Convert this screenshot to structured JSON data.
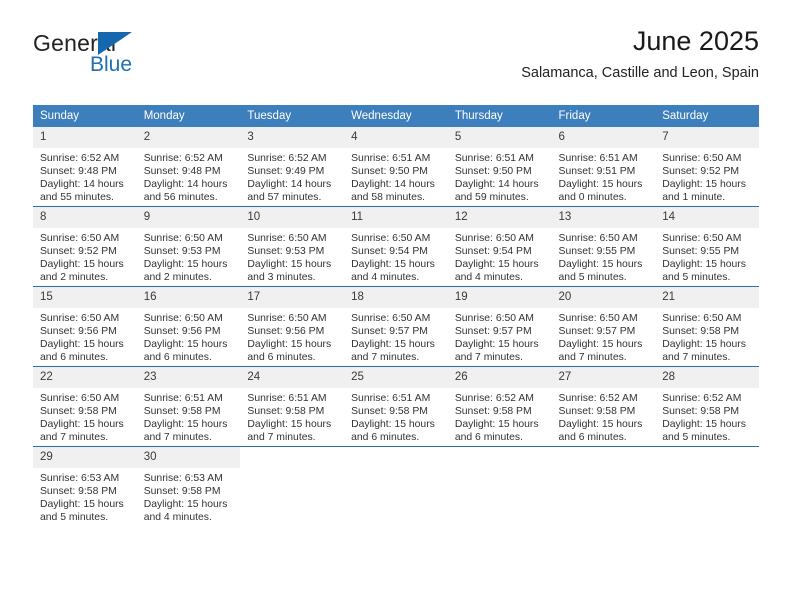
{
  "brand": {
    "name_part1": "General",
    "name_part2": "Blue",
    "flag_icon": "blue-flag-icon",
    "accent_color": "#1568ad"
  },
  "header": {
    "title": "June 2025",
    "subtitle": "Salamanca, Castille and Leon, Spain"
  },
  "theme": {
    "header_row_background": "#3d7ebd",
    "row_divider_color": "#2e6da4",
    "daynum_background": "#f0f0f0"
  },
  "calendar": {
    "weekday_headers": [
      "Sunday",
      "Monday",
      "Tuesday",
      "Wednesday",
      "Thursday",
      "Friday",
      "Saturday"
    ],
    "weeks": [
      [
        {
          "day": "1",
          "sunrise": "Sunrise: 6:52 AM",
          "sunset": "Sunset: 9:48 PM",
          "daylight_line1": "Daylight: 14 hours",
          "daylight_line2": "and 55 minutes."
        },
        {
          "day": "2",
          "sunrise": "Sunrise: 6:52 AM",
          "sunset": "Sunset: 9:48 PM",
          "daylight_line1": "Daylight: 14 hours",
          "daylight_line2": "and 56 minutes."
        },
        {
          "day": "3",
          "sunrise": "Sunrise: 6:52 AM",
          "sunset": "Sunset: 9:49 PM",
          "daylight_line1": "Daylight: 14 hours",
          "daylight_line2": "and 57 minutes."
        },
        {
          "day": "4",
          "sunrise": "Sunrise: 6:51 AM",
          "sunset": "Sunset: 9:50 PM",
          "daylight_line1": "Daylight: 14 hours",
          "daylight_line2": "and 58 minutes."
        },
        {
          "day": "5",
          "sunrise": "Sunrise: 6:51 AM",
          "sunset": "Sunset: 9:50 PM",
          "daylight_line1": "Daylight: 14 hours",
          "daylight_line2": "and 59 minutes."
        },
        {
          "day": "6",
          "sunrise": "Sunrise: 6:51 AM",
          "sunset": "Sunset: 9:51 PM",
          "daylight_line1": "Daylight: 15 hours",
          "daylight_line2": "and 0 minutes."
        },
        {
          "day": "7",
          "sunrise": "Sunrise: 6:50 AM",
          "sunset": "Sunset: 9:52 PM",
          "daylight_line1": "Daylight: 15 hours",
          "daylight_line2": "and 1 minute."
        }
      ],
      [
        {
          "day": "8",
          "sunrise": "Sunrise: 6:50 AM",
          "sunset": "Sunset: 9:52 PM",
          "daylight_line1": "Daylight: 15 hours",
          "daylight_line2": "and 2 minutes."
        },
        {
          "day": "9",
          "sunrise": "Sunrise: 6:50 AM",
          "sunset": "Sunset: 9:53 PM",
          "daylight_line1": "Daylight: 15 hours",
          "daylight_line2": "and 2 minutes."
        },
        {
          "day": "10",
          "sunrise": "Sunrise: 6:50 AM",
          "sunset": "Sunset: 9:53 PM",
          "daylight_line1": "Daylight: 15 hours",
          "daylight_line2": "and 3 minutes."
        },
        {
          "day": "11",
          "sunrise": "Sunrise: 6:50 AM",
          "sunset": "Sunset: 9:54 PM",
          "daylight_line1": "Daylight: 15 hours",
          "daylight_line2": "and 4 minutes."
        },
        {
          "day": "12",
          "sunrise": "Sunrise: 6:50 AM",
          "sunset": "Sunset: 9:54 PM",
          "daylight_line1": "Daylight: 15 hours",
          "daylight_line2": "and 4 minutes."
        },
        {
          "day": "13",
          "sunrise": "Sunrise: 6:50 AM",
          "sunset": "Sunset: 9:55 PM",
          "daylight_line1": "Daylight: 15 hours",
          "daylight_line2": "and 5 minutes."
        },
        {
          "day": "14",
          "sunrise": "Sunrise: 6:50 AM",
          "sunset": "Sunset: 9:55 PM",
          "daylight_line1": "Daylight: 15 hours",
          "daylight_line2": "and 5 minutes."
        }
      ],
      [
        {
          "day": "15",
          "sunrise": "Sunrise: 6:50 AM",
          "sunset": "Sunset: 9:56 PM",
          "daylight_line1": "Daylight: 15 hours",
          "daylight_line2": "and 6 minutes."
        },
        {
          "day": "16",
          "sunrise": "Sunrise: 6:50 AM",
          "sunset": "Sunset: 9:56 PM",
          "daylight_line1": "Daylight: 15 hours",
          "daylight_line2": "and 6 minutes."
        },
        {
          "day": "17",
          "sunrise": "Sunrise: 6:50 AM",
          "sunset": "Sunset: 9:56 PM",
          "daylight_line1": "Daylight: 15 hours",
          "daylight_line2": "and 6 minutes."
        },
        {
          "day": "18",
          "sunrise": "Sunrise: 6:50 AM",
          "sunset": "Sunset: 9:57 PM",
          "daylight_line1": "Daylight: 15 hours",
          "daylight_line2": "and 7 minutes."
        },
        {
          "day": "19",
          "sunrise": "Sunrise: 6:50 AM",
          "sunset": "Sunset: 9:57 PM",
          "daylight_line1": "Daylight: 15 hours",
          "daylight_line2": "and 7 minutes."
        },
        {
          "day": "20",
          "sunrise": "Sunrise: 6:50 AM",
          "sunset": "Sunset: 9:57 PM",
          "daylight_line1": "Daylight: 15 hours",
          "daylight_line2": "and 7 minutes."
        },
        {
          "day": "21",
          "sunrise": "Sunrise: 6:50 AM",
          "sunset": "Sunset: 9:58 PM",
          "daylight_line1": "Daylight: 15 hours",
          "daylight_line2": "and 7 minutes."
        }
      ],
      [
        {
          "day": "22",
          "sunrise": "Sunrise: 6:50 AM",
          "sunset": "Sunset: 9:58 PM",
          "daylight_line1": "Daylight: 15 hours",
          "daylight_line2": "and 7 minutes."
        },
        {
          "day": "23",
          "sunrise": "Sunrise: 6:51 AM",
          "sunset": "Sunset: 9:58 PM",
          "daylight_line1": "Daylight: 15 hours",
          "daylight_line2": "and 7 minutes."
        },
        {
          "day": "24",
          "sunrise": "Sunrise: 6:51 AM",
          "sunset": "Sunset: 9:58 PM",
          "daylight_line1": "Daylight: 15 hours",
          "daylight_line2": "and 7 minutes."
        },
        {
          "day": "25",
          "sunrise": "Sunrise: 6:51 AM",
          "sunset": "Sunset: 9:58 PM",
          "daylight_line1": "Daylight: 15 hours",
          "daylight_line2": "and 6 minutes."
        },
        {
          "day": "26",
          "sunrise": "Sunrise: 6:52 AM",
          "sunset": "Sunset: 9:58 PM",
          "daylight_line1": "Daylight: 15 hours",
          "daylight_line2": "and 6 minutes."
        },
        {
          "day": "27",
          "sunrise": "Sunrise: 6:52 AM",
          "sunset": "Sunset: 9:58 PM",
          "daylight_line1": "Daylight: 15 hours",
          "daylight_line2": "and 6 minutes."
        },
        {
          "day": "28",
          "sunrise": "Sunrise: 6:52 AM",
          "sunset": "Sunset: 9:58 PM",
          "daylight_line1": "Daylight: 15 hours",
          "daylight_line2": "and 5 minutes."
        }
      ],
      [
        {
          "day": "29",
          "sunrise": "Sunrise: 6:53 AM",
          "sunset": "Sunset: 9:58 PM",
          "daylight_line1": "Daylight: 15 hours",
          "daylight_line2": "and 5 minutes."
        },
        {
          "day": "30",
          "sunrise": "Sunrise: 6:53 AM",
          "sunset": "Sunset: 9:58 PM",
          "daylight_line1": "Daylight: 15 hours",
          "daylight_line2": "and 4 minutes."
        },
        {
          "day": "",
          "sunrise": "",
          "sunset": "",
          "daylight_line1": "",
          "daylight_line2": ""
        },
        {
          "day": "",
          "sunrise": "",
          "sunset": "",
          "daylight_line1": "",
          "daylight_line2": ""
        },
        {
          "day": "",
          "sunrise": "",
          "sunset": "",
          "daylight_line1": "",
          "daylight_line2": ""
        },
        {
          "day": "",
          "sunrise": "",
          "sunset": "",
          "daylight_line1": "",
          "daylight_line2": ""
        },
        {
          "day": "",
          "sunrise": "",
          "sunset": "",
          "daylight_line1": "",
          "daylight_line2": ""
        }
      ]
    ]
  }
}
